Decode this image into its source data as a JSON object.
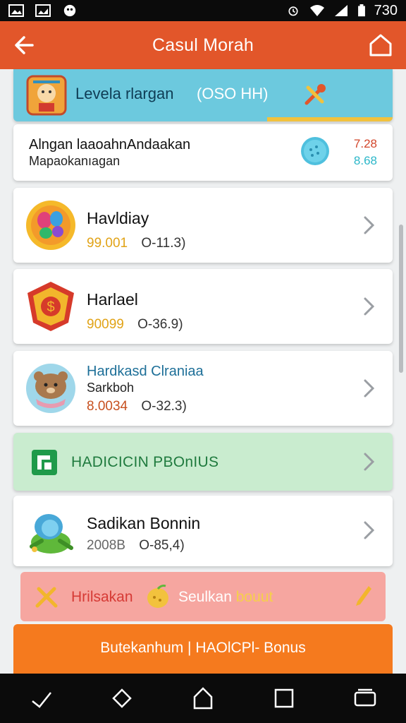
{
  "status_bar": {
    "time": "730"
  },
  "app_bar": {
    "title": "Casul Morah"
  },
  "level_banner": {
    "name": "Levela rlargan",
    "time": "(OSO HH)"
  },
  "info_card": {
    "line1": "Alngan laaoahnAndaakan",
    "line2": "Mapaokanıagan",
    "value1": "7.28",
    "value2": "8.68"
  },
  "games": [
    {
      "title": "Havldiay",
      "amount": "99.001",
      "rate": "O-11.3)"
    },
    {
      "title": "Harlael",
      "amount": "90099",
      "rate": "O-36.9)"
    },
    {
      "title": "Hardkasd Clraniaa",
      "subtitle": "Sarkboh",
      "amount": "8.0034",
      "rate": "O-32.3)"
    }
  ],
  "bonus_banner": {
    "label": "HADICICIN PBOnIUS"
  },
  "game_5": {
    "title": "Sadikan Bonnin",
    "amount": "2008B",
    "rate": "O-85,4)"
  },
  "red_banner": {
    "label1": "Hrilsakan",
    "label2_main": "Seulkan ",
    "label2_highlight": "bouut"
  },
  "orange_banner": {
    "label": "Butekanhum | HAOlCPl- Bonus"
  },
  "colors": {
    "app_bar": "#e2562a",
    "level_banner": "#6cc9de",
    "bonus_banner": "#c9eccf",
    "red_banner": "#f6a6a0",
    "orange_banner": "#f57a1e",
    "amount": "#e1a317"
  },
  "icons": [
    "back-arrow-icon",
    "home-icon",
    "mascot-badge-icon",
    "tools-icon",
    "ball-icon",
    "palette-icon",
    "coin-badge-icon",
    "bear-icon",
    "bonus-logo-icon",
    "frog-icon",
    "fruit-icon",
    "pencil-icon",
    "chevron-right-icon"
  ]
}
